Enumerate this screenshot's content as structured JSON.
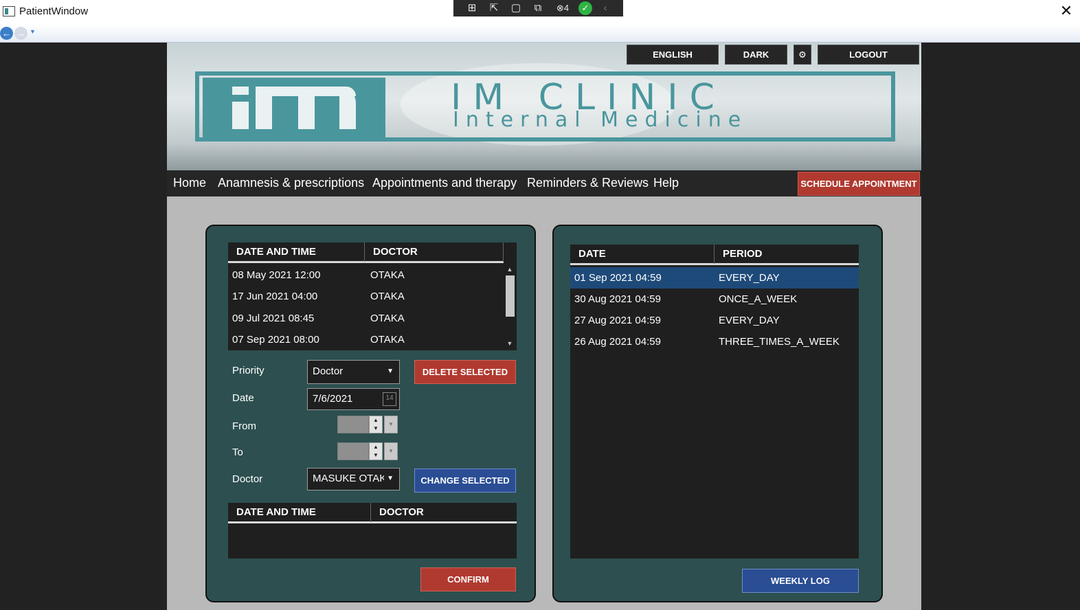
{
  "window": {
    "title": "PatientWindow",
    "close_icon": "✕"
  },
  "debug_toolbar": {
    "badge_count": "4"
  },
  "header": {
    "language_button": "ENGLISH",
    "theme_button": "DARK",
    "logout_button": "LOGOUT",
    "brand_title": "IM CLINIC",
    "brand_subtitle": "Internal Medicine",
    "brand_color": "#4a969d"
  },
  "menu": {
    "items": [
      "Home",
      "Anamnesis & prescriptions",
      "Appointments and therapy",
      "Reminders & Reviews",
      "Help"
    ],
    "schedule_button": "SCHEDULE APPOINTMENT"
  },
  "appointments": {
    "columns": [
      "DATE AND TIME",
      "DOCTOR"
    ],
    "rows": [
      [
        "08 May 2021 12:00",
        "OTAKA"
      ],
      [
        "17 Jun 2021 04:00",
        "OTAKA"
      ],
      [
        "09 Jul 2021 08:45",
        "OTAKA"
      ],
      [
        "07 Sep 2021 08:00",
        "OTAKA"
      ]
    ]
  },
  "form": {
    "priority_label": "Priority",
    "priority_value": "Doctor",
    "date_label": "Date",
    "date_value": "7/6/2021",
    "date_icon_text": "14",
    "from_label": "From",
    "to_label": "To",
    "doctor_label": "Doctor",
    "doctor_value": "MASUKE OTAKA",
    "delete_button": "DELETE SELECTED",
    "change_button": "CHANGE SELECTED"
  },
  "suggested": {
    "columns": [
      "DATE AND TIME",
      "DOCTOR"
    ],
    "rows": []
  },
  "confirm_button": "CONFIRM",
  "therapy": {
    "columns": [
      "DATE",
      "PERIOD"
    ],
    "rows": [
      [
        "01 Sep 2021 04:59",
        "EVERY_DAY"
      ],
      [
        "30 Aug 2021 04:59",
        "ONCE_A_WEEK"
      ],
      [
        "27 Aug 2021 04:59",
        "EVERY_DAY"
      ],
      [
        "26 Aug 2021 04:59",
        "THREE_TIMES_A_WEEK"
      ]
    ],
    "selected_row": 0
  },
  "weekly_log_button": "WEEKLY LOG"
}
